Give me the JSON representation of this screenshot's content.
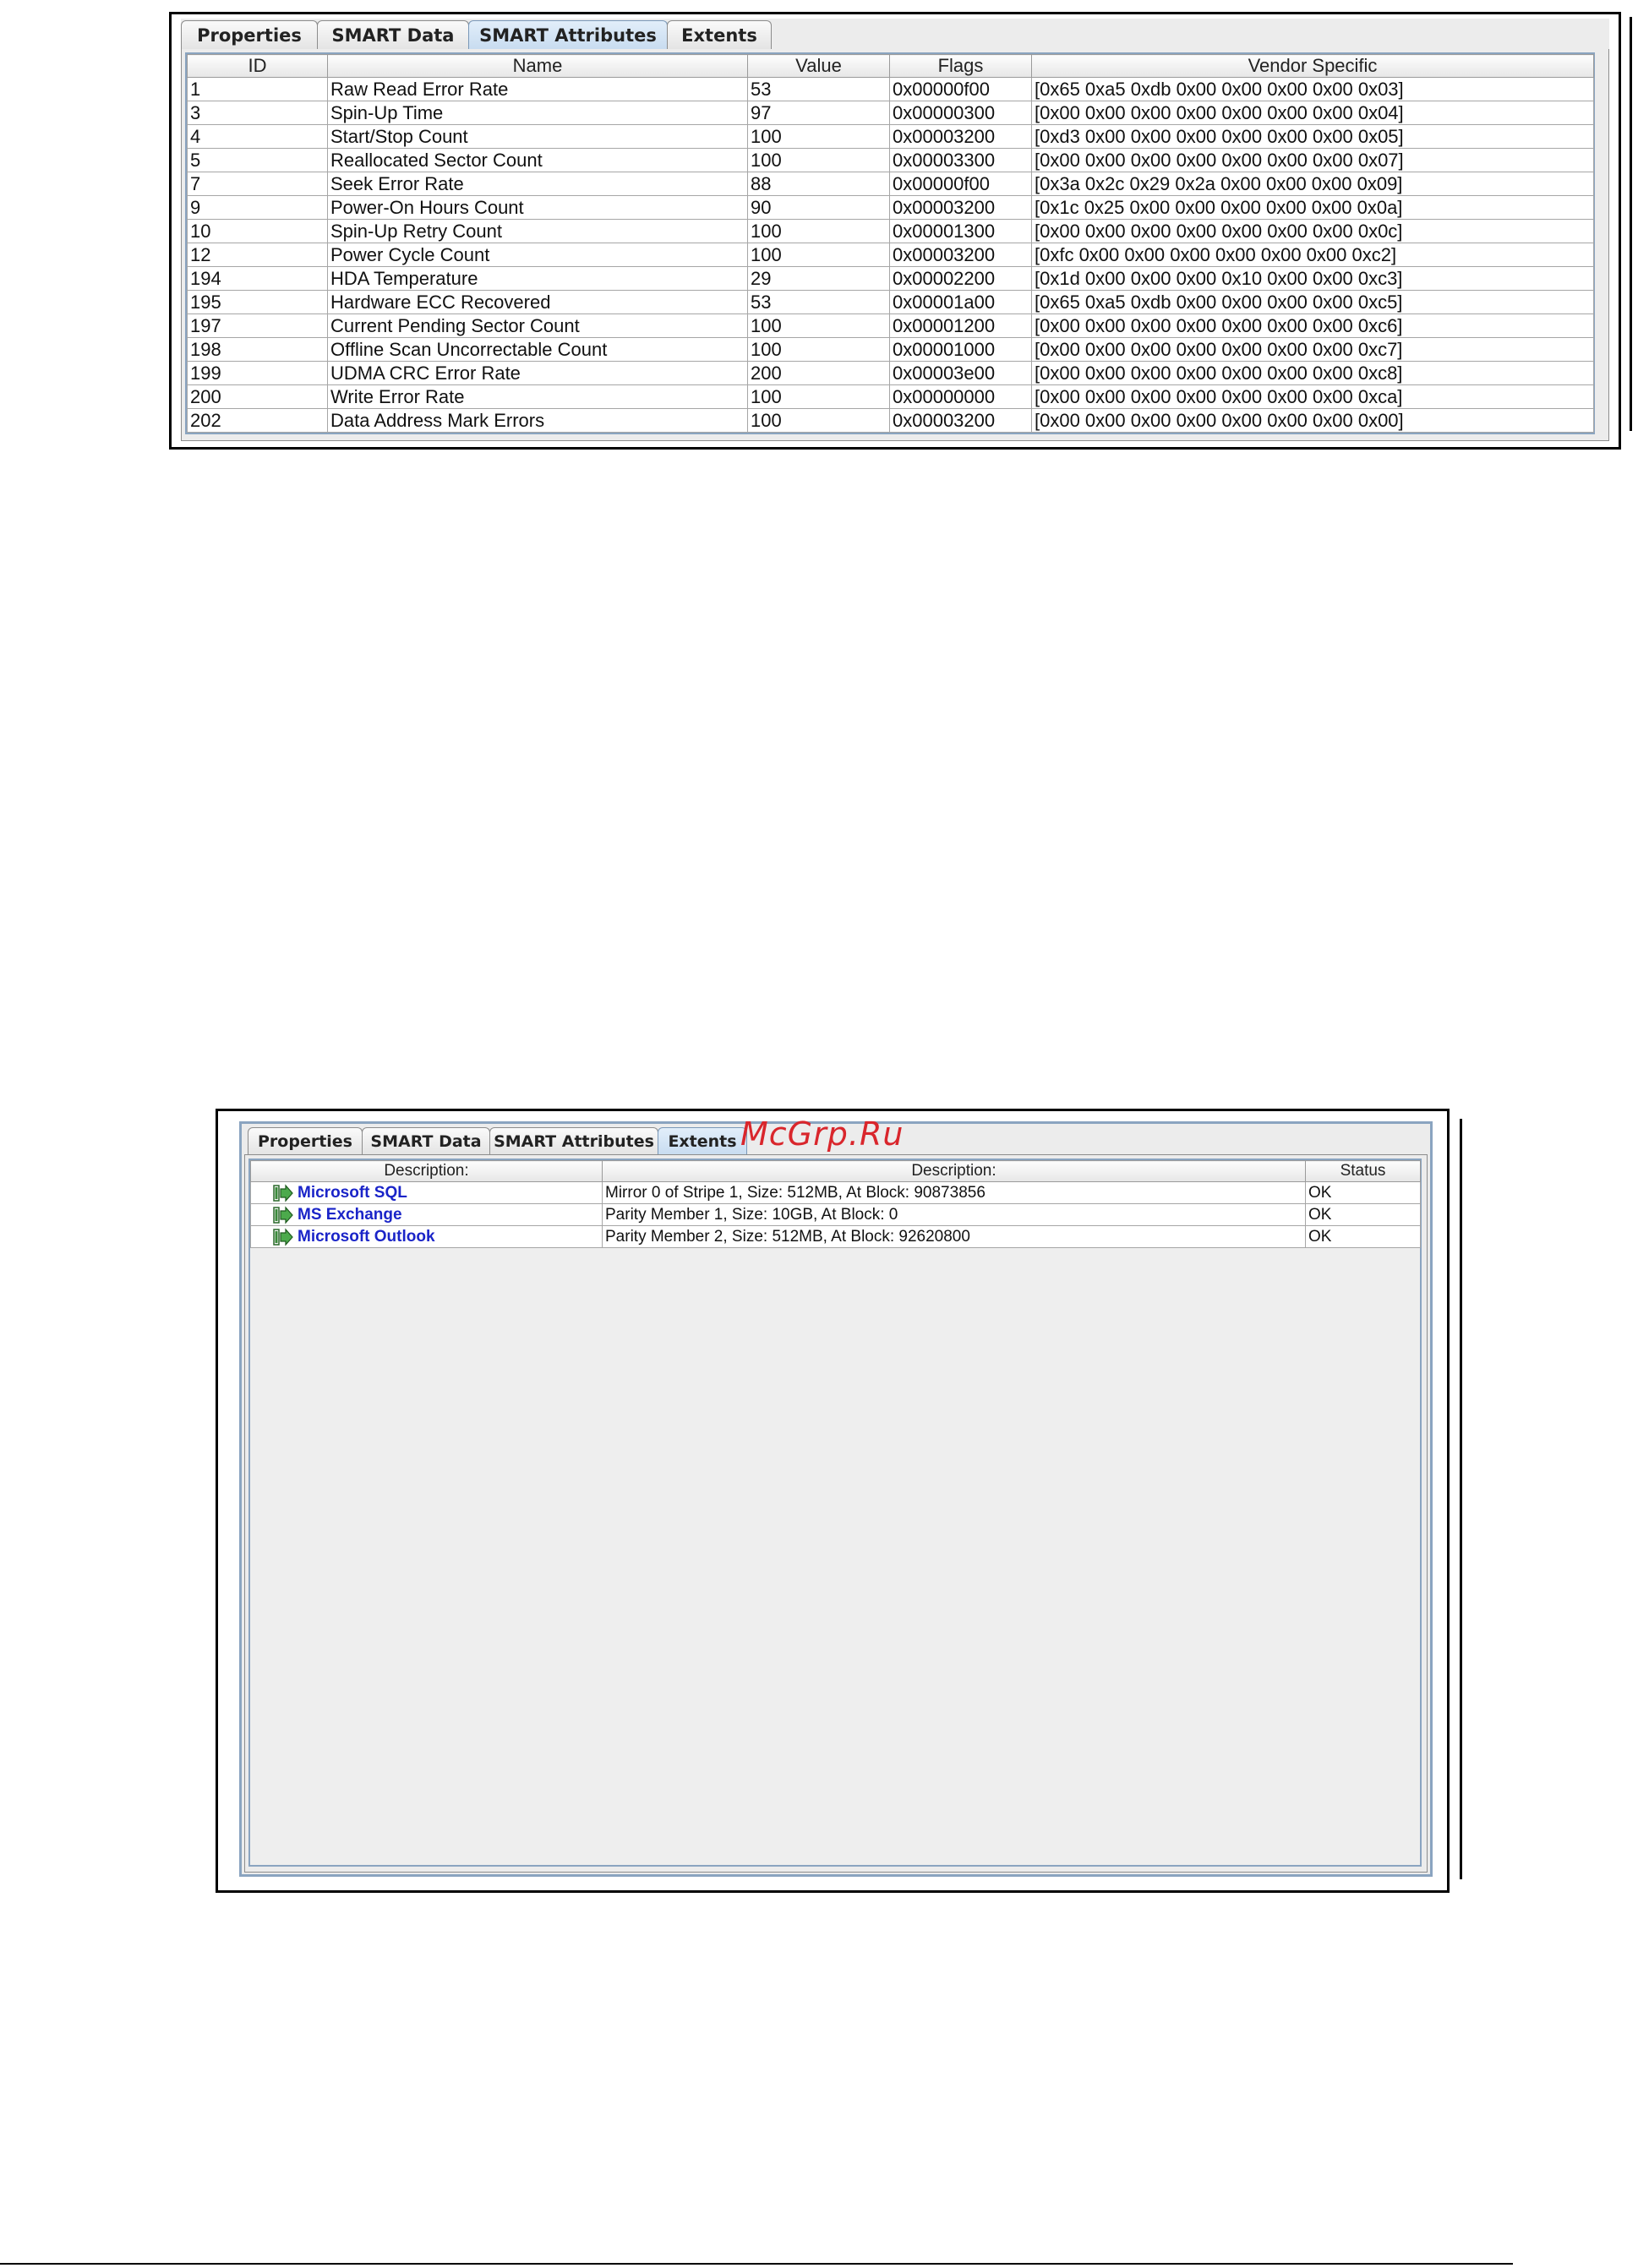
{
  "smart_panel": {
    "tabs": [
      "Properties",
      "SMART Data",
      "SMART Attributes",
      "Extents"
    ],
    "active_tab": 2,
    "columns": [
      "ID",
      "Name",
      "Value",
      "Flags",
      "Vendor Specific"
    ],
    "rows": [
      [
        "1",
        "Raw Read Error Rate",
        "53",
        "0x00000f00",
        "[0x65 0xa5 0xdb 0x00 0x00 0x00 0x00 0x03]"
      ],
      [
        "3",
        "Spin-Up Time",
        "97",
        "0x00000300",
        "[0x00 0x00 0x00 0x00 0x00 0x00 0x00 0x04]"
      ],
      [
        "4",
        "Start/Stop Count",
        "100",
        "0x00003200",
        "[0xd3 0x00 0x00 0x00 0x00 0x00 0x00 0x05]"
      ],
      [
        "5",
        "Reallocated Sector Count",
        "100",
        "0x00003300",
        "[0x00 0x00 0x00 0x00 0x00 0x00 0x00 0x07]"
      ],
      [
        "7",
        "Seek Error Rate",
        "88",
        "0x00000f00",
        "[0x3a 0x2c 0x29 0x2a 0x00 0x00 0x00 0x09]"
      ],
      [
        "9",
        "Power-On Hours Count",
        "90",
        "0x00003200",
        "[0x1c 0x25 0x00 0x00 0x00 0x00 0x00 0x0a]"
      ],
      [
        "10",
        "Spin-Up Retry Count",
        "100",
        "0x00001300",
        "[0x00 0x00 0x00 0x00 0x00 0x00 0x00 0x0c]"
      ],
      [
        "12",
        "Power Cycle Count",
        "100",
        "0x00003200",
        "[0xfc 0x00 0x00 0x00 0x00 0x00 0x00 0xc2]"
      ],
      [
        "194",
        "HDA Temperature",
        "29",
        "0x00002200",
        "[0x1d 0x00 0x00 0x00 0x10 0x00 0x00 0xc3]"
      ],
      [
        "195",
        "Hardware ECC Recovered",
        "53",
        "0x00001a00",
        "[0x65 0xa5 0xdb 0x00 0x00 0x00 0x00 0xc5]"
      ],
      [
        "197",
        "Current Pending Sector Count",
        "100",
        "0x00001200",
        "[0x00 0x00 0x00 0x00 0x00 0x00 0x00 0xc6]"
      ],
      [
        "198",
        "Offline Scan Uncorrectable Count",
        "100",
        "0x00001000",
        "[0x00 0x00 0x00 0x00 0x00 0x00 0x00 0xc7]"
      ],
      [
        "199",
        "UDMA CRC Error Rate",
        "200",
        "0x00003e00",
        "[0x00 0x00 0x00 0x00 0x00 0x00 0x00 0xc8]"
      ],
      [
        "200",
        "Write Error Rate",
        "100",
        "0x00000000",
        "[0x00 0x00 0x00 0x00 0x00 0x00 0x00 0xca]"
      ],
      [
        "202",
        "Data Address Mark Errors",
        "100",
        "0x00003200",
        "[0x00 0x00 0x00 0x00 0x00 0x00 0x00 0x00]"
      ]
    ]
  },
  "extents_panel": {
    "tabs": [
      "Properties",
      "SMART Data",
      "SMART Attributes",
      "Extents"
    ],
    "active_tab": 3,
    "columns": [
      "Description:",
      "Description:",
      "Status"
    ],
    "rows": [
      {
        "name": "Microsoft SQL",
        "icon": "volume-icon",
        "description": "Mirror 0 of Stripe 1, Size: 512MB, At Block: 90873856",
        "status": "OK"
      },
      {
        "name": "MS Exchange",
        "icon": "volume-icon",
        "description": "Parity Member 1, Size: 10GB, At Block: 0",
        "status": "OK"
      },
      {
        "name": "Microsoft Outlook",
        "icon": "volume-icon",
        "description": "Parity Member 2, Size: 512MB, At Block: 92620800",
        "status": "OK"
      }
    ]
  },
  "watermark": "McGrp.Ru",
  "colors": {
    "active_tab": "#c8dcf0",
    "link": "#1a24c8",
    "grid_border": "#8aa4c0",
    "watermark": "#d9262c"
  }
}
